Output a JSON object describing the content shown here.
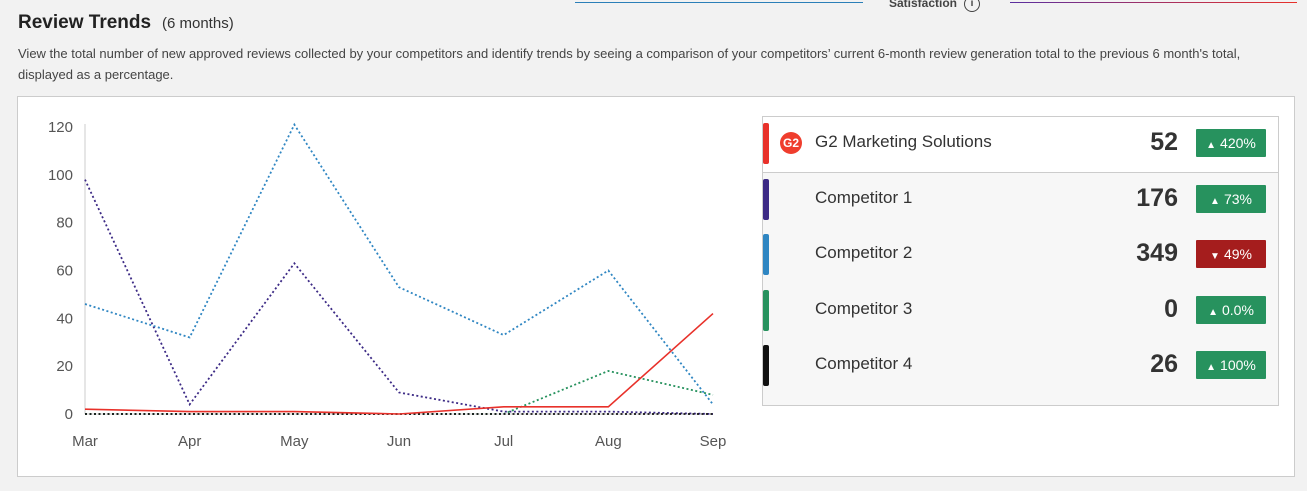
{
  "header": {
    "satisfaction_label": "Satisfaction",
    "info_icon": "info-circle-icon",
    "title": "Review Trends",
    "subtitle": "(6 months)",
    "description": "View the total number of new approved reviews collected by your competitors and identify trends by seeing a comparison of your competitors’ current 6-month review generation total to the previous 6 month's total, displayed as a percentage."
  },
  "chart_data": {
    "type": "line",
    "categories": [
      "Mar",
      "Apr",
      "May",
      "Jun",
      "Jul",
      "Aug",
      "Sep"
    ],
    "ylim": [
      0,
      120
    ],
    "yticks": [
      0,
      20,
      40,
      60,
      80,
      100,
      120
    ],
    "grid": false,
    "series": [
      {
        "name": "G2 Marketing Solutions",
        "color": "#e8312a",
        "style": "solid",
        "values": [
          2,
          1,
          1,
          0,
          3,
          3,
          42
        ]
      },
      {
        "name": "Competitor 1",
        "color": "#3c2a85",
        "style": "dotted",
        "values": [
          98,
          4,
          63,
          9,
          1,
          1,
          0
        ]
      },
      {
        "name": "Competitor 2",
        "color": "#2f86c2",
        "style": "dotted",
        "values": [
          46,
          32,
          121,
          53,
          33,
          60,
          4
        ]
      },
      {
        "name": "Competitor 3",
        "color": "#27925e",
        "style": "dotted",
        "values": [
          0,
          0,
          0,
          0,
          0,
          18,
          8
        ]
      },
      {
        "name": "Competitor 4",
        "color": "#111111",
        "style": "dotted",
        "values": [
          0,
          0,
          0,
          0,
          0,
          0,
          0
        ]
      }
    ]
  },
  "legend": {
    "rows": [
      {
        "name": "G2 Marketing Solutions",
        "count": "52",
        "change": "420%",
        "direction": "up",
        "color": "#e8312a",
        "badge_color": "#27925e",
        "logo": "G2"
      },
      {
        "name": "Competitor 1",
        "count": "176",
        "change": "73%",
        "direction": "up",
        "color": "#3c2a85",
        "badge_color": "#27925e"
      },
      {
        "name": "Competitor 2",
        "count": "349",
        "change": "49%",
        "direction": "down",
        "color": "#2f86c2",
        "badge_color": "#a51d1d"
      },
      {
        "name": "Competitor 3",
        "count": "0",
        "change": "0.0%",
        "direction": "up",
        "color": "#27925e",
        "badge_color": "#27925e"
      },
      {
        "name": "Competitor 4",
        "count": "26",
        "change": "100%",
        "direction": "up",
        "color": "#111111",
        "badge_color": "#27925e"
      }
    ]
  }
}
